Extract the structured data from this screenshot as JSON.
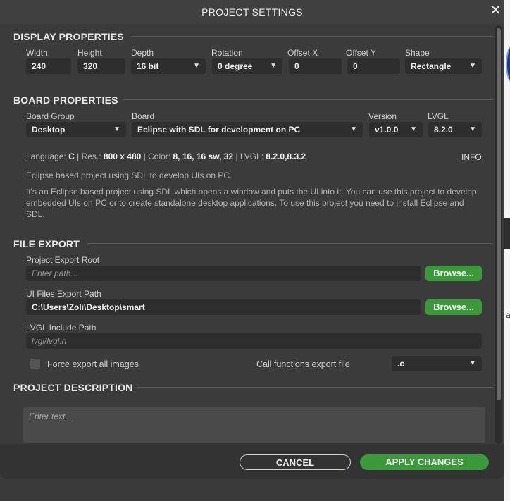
{
  "dialog": {
    "title": "PROJECT SETTINGS"
  },
  "display": {
    "title": "DISPLAY PROPERTIES",
    "width_label": "Width",
    "width_value": "240",
    "height_label": "Height",
    "height_value": "320",
    "depth_label": "Depth",
    "depth_value": "16 bit",
    "rotation_label": "Rotation",
    "rotation_value": "0 degree",
    "offset_x_label": "Offset X",
    "offset_x_value": "0",
    "offset_y_label": "Offset Y",
    "offset_y_value": "0",
    "shape_label": "Shape",
    "shape_value": "Rectangle"
  },
  "board": {
    "title": "BOARD PROPERTIES",
    "group_label": "Board Group",
    "group_value": "Desktop",
    "board_label": "Board",
    "board_value": "Eclipse with SDL for development on PC",
    "version_label": "Version",
    "version_value": "v1.0.0",
    "lvgl_label": "LVGL",
    "lvgl_value": "8.2.0",
    "language_label": "Language:",
    "language_value": "C",
    "res_label": "Res.:",
    "res_value": "800 x 480",
    "color_label": "Color:",
    "color_value": "8, 16, 16 sw, 32",
    "lvgl_meta_label": "LVGL:",
    "lvgl_meta_value": "8.2.0,8.3.2",
    "separator": "|",
    "info_link": "INFO",
    "short_desc": "Eclipse based project using SDL to develop UIs on PC.",
    "long_desc": "It's an Eclipse based project using SDL which opens a window and puts the UI into it. You can use this project to develop embedded UIs on PC or to create standalone desktop applications. To use this project you need to install Eclipse and SDL."
  },
  "export": {
    "title": "FILE EXPORT",
    "root_label": "Project Export Root",
    "root_placeholder": "Enter path...",
    "ui_label": "UI Files Export Path",
    "ui_value": "C:\\Users\\Zoli\\Desktop\\smart",
    "include_label": "LVGL Include Path",
    "include_placeholder": "lvgl/lvgl.h",
    "browse_label": "Browse...",
    "force_label": "Force export all images",
    "call_label": "Call functions export file",
    "call_value": ".c"
  },
  "description": {
    "title": "PROJECT DESCRIPTION",
    "placeholder": "Enter text..."
  },
  "footer": {
    "cancel": "CANCEL",
    "apply": "APPLY CHANGES"
  },
  "background": {
    "edge_char": "a"
  },
  "colors": {
    "accent_green": "#3a9a3a",
    "dialog_bg": "#3b3b3b",
    "field_bg": "#2e2e2e"
  }
}
